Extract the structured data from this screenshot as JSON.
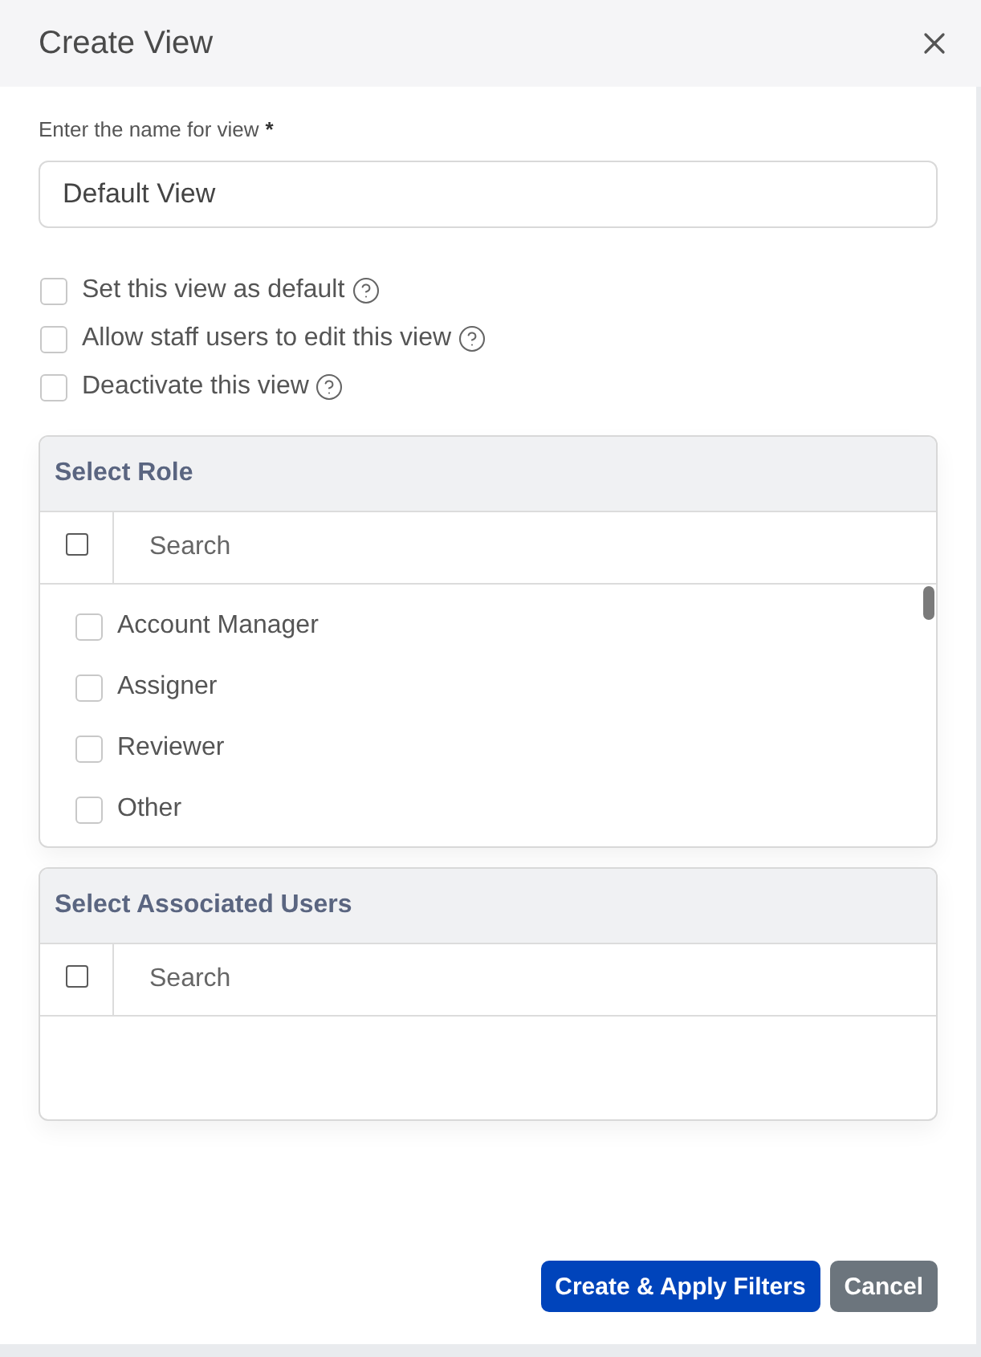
{
  "dialog": {
    "title": "Create View"
  },
  "name_field": {
    "label": "Enter the name for view",
    "required_mark": "*",
    "value": "Default View"
  },
  "options": [
    {
      "label": "Set this view as default",
      "checked": false
    },
    {
      "label": "Allow staff users to edit this view",
      "checked": false
    },
    {
      "label": "Deactivate this view",
      "checked": false
    }
  ],
  "panels": [
    {
      "title": "Select Role",
      "select_all": {
        "checked": false
      },
      "search": {
        "placeholder": "Search"
      },
      "items": [
        {
          "label": "Account Manager",
          "checked": false
        },
        {
          "label": "Assigner",
          "checked": false
        },
        {
          "label": "Reviewer",
          "checked": false
        },
        {
          "label": "Other",
          "checked": false
        }
      ]
    },
    {
      "title": "Select Associated Users",
      "select_all": {
        "checked": false
      },
      "search": {
        "placeholder": "Search"
      }
    }
  ],
  "buttons": [
    {
      "label": "Create & Apply Filters",
      "kind": "primary"
    },
    {
      "label": "Cancel",
      "kind": "secondary"
    }
  ]
}
